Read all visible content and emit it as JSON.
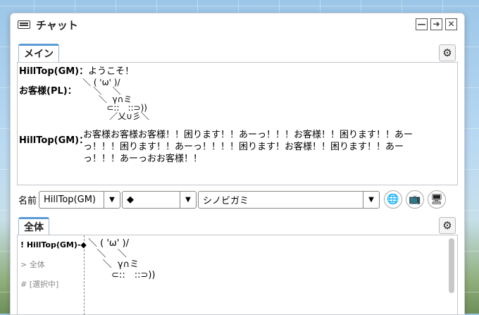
{
  "window": {
    "title": "チャット",
    "buttons": {
      "minimize": "—",
      "popout": "➔",
      "close": "✕"
    }
  },
  "main_panel": {
    "tab": "メイン",
    "messages": [
      {
        "sender": "HillTop(GM)：",
        "text": "ようこそ！"
      },
      {
        "sender": "お客様(PL)：",
        "ascii_art": "＼ ( 'ω' )/\n    ＼    ＼\n      ＼  γ∩ミ\n         ⊂::　::⊃))\n          ／乂∪彡＼"
      },
      {
        "sender": "HillTop(GM)：",
        "text": "お客様お客様お客様！！困ります！！あーっ！！！お客様！！困ります！！あーっ！！！困ります！！あーっ！！！！困ります！お客様！！困ります！！あーっ！！！あーっおお客様！！"
      }
    ]
  },
  "name_bar": {
    "label": "名前",
    "name_value": "HillTop(GM)",
    "color_value": "◆",
    "character_value": "シノビガミ"
  },
  "icons": {
    "globe": "globe-icon",
    "tv": "tv-icon",
    "monitor": "monitor-icon",
    "gear": "gear-icon"
  },
  "sub_panel": {
    "tab": "全体",
    "side_items": [
      "! HillTop(GM)-◆",
      "> 全体",
      "# [選択中]"
    ],
    "ascii_art": "＼ ( 'ω' )/\n   ＼    ＼\n     ＼  γ∩ミ\n        ⊂::　::⊃))"
  }
}
